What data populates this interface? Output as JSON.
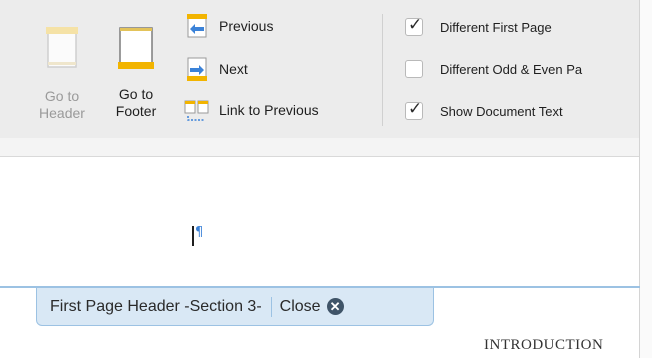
{
  "ribbon": {
    "go_to_header": {
      "line1": "Go to",
      "line2": "Header",
      "enabled": false,
      "icon": "header-doc-icon"
    },
    "go_to_footer": {
      "line1": "Go to",
      "line2": "Footer",
      "enabled": true,
      "icon": "footer-doc-icon"
    },
    "navigation": [
      {
        "label": "Previous",
        "icon": "previous-section-icon"
      },
      {
        "label": "Next",
        "icon": "next-section-icon"
      },
      {
        "label": "Link to Previous",
        "icon": "link-to-previous-icon"
      }
    ],
    "options": [
      {
        "label": "Different First Page",
        "checked": true
      },
      {
        "label": "Different Odd & Even Pa",
        "checked": false
      },
      {
        "label": "Show Document Text",
        "checked": true
      }
    ]
  },
  "document": {
    "paragraph_mark": "¶",
    "header_tab": {
      "title": "First Page Header -Section 3-",
      "close_label": "Close",
      "close_icon": "close-circle-icon"
    },
    "heading_text": "INTRODUCTION"
  },
  "colors": {
    "ribbon_bg": "#ececec",
    "accent_blue": "#3b82d8",
    "icon_yellow": "#f2b400",
    "header_tab_bg": "#d9e8f5",
    "header_tab_border": "#9cc2e3"
  }
}
